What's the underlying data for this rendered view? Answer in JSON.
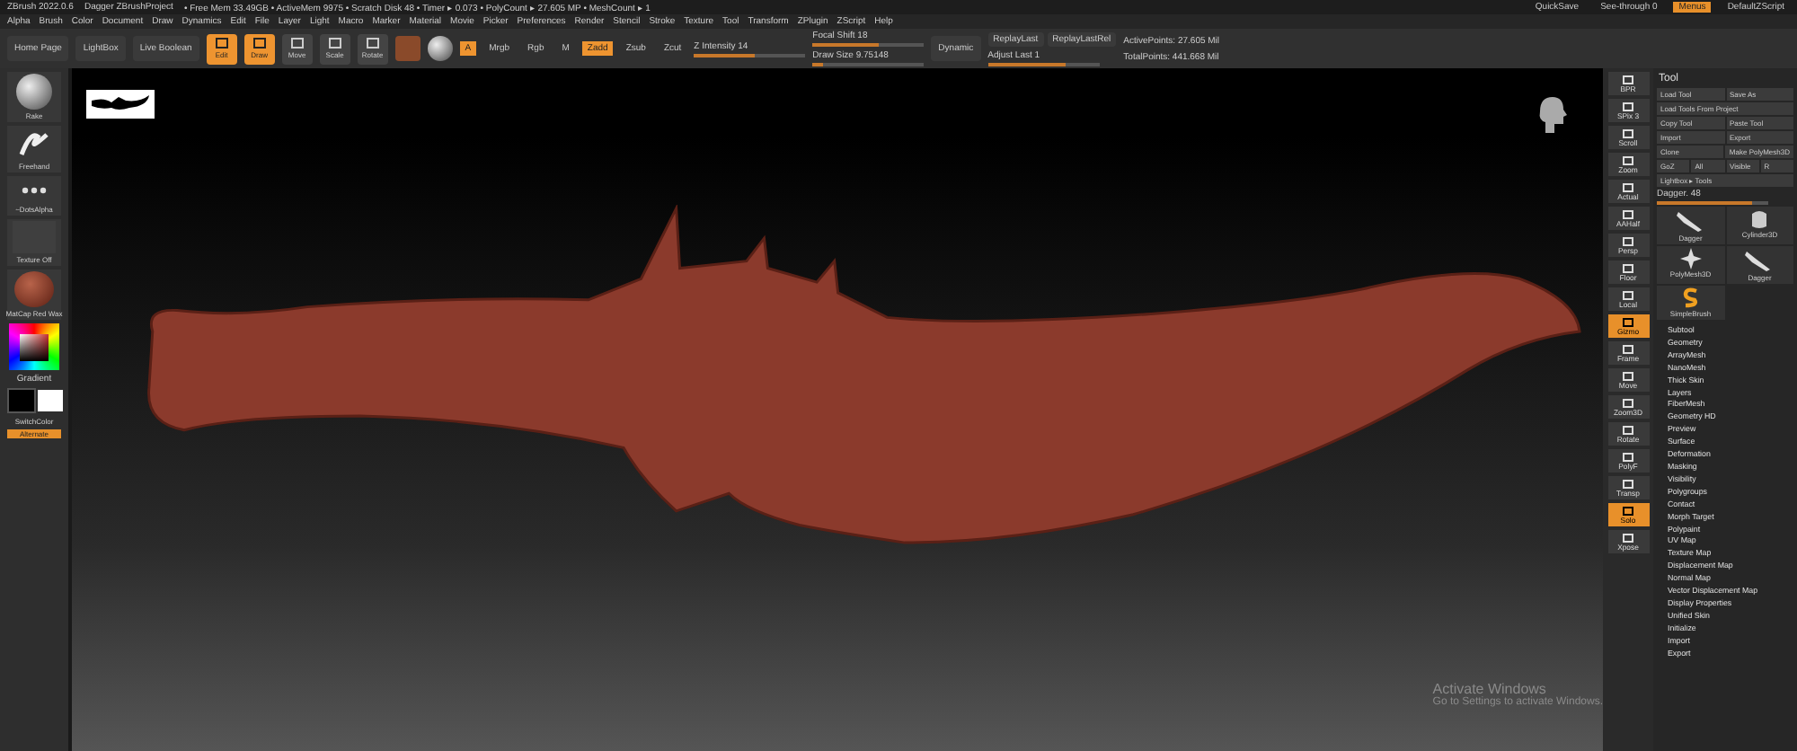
{
  "title_bar": {
    "app": "ZBrush 2022.0.6",
    "project": "Dagger ZBrushProject",
    "stats": "• Free Mem 33.49GB • ActiveMem 9975 • Scratch Disk 48 • Timer ▸ 0.073 • PolyCount ▸ 27.605 MP • MeshCount ▸ 1"
  },
  "title_buttons": [
    {
      "label": "QuickSave",
      "selected": false
    },
    {
      "label": "See-through 0",
      "selected": false
    },
    {
      "label": "Menus",
      "selected": true
    },
    {
      "label": "DefaultZScript",
      "selected": false
    }
  ],
  "menu": [
    "Alpha",
    "Brush",
    "Color",
    "Document",
    "Draw",
    "Dynamics",
    "Edit",
    "File",
    "Layer",
    "Light",
    "Macro",
    "Marker",
    "Material",
    "Movie",
    "Picker",
    "Preferences",
    "Render",
    "Stencil",
    "Stroke",
    "Texture",
    "Tool",
    "Transform",
    "ZPlugin",
    "ZScript",
    "Help"
  ],
  "toolbar": {
    "nav": [
      "Home Page",
      "LightBox",
      "Live Boolean"
    ],
    "modes": [
      {
        "label": "Edit",
        "selected": true
      },
      {
        "label": "Draw",
        "selected": true
      },
      {
        "label": "Move",
        "selected": false
      },
      {
        "label": "Scale",
        "selected": false
      },
      {
        "label": "Rotate",
        "selected": false
      }
    ],
    "channels": [
      {
        "label": "A",
        "selected": true
      },
      {
        "label": "Mrgb",
        "selected": false
      },
      {
        "label": "Rgb",
        "selected": false
      },
      {
        "label": "M",
        "selected": false
      },
      {
        "label": "Zadd",
        "selected": true
      },
      {
        "label": "Zsub",
        "selected": false
      },
      {
        "label": "Zcut",
        "selected": false
      }
    ],
    "sliders": [
      {
        "label": "Z Intensity 14",
        "level": 0.55
      },
      {
        "label": "Focal Shift 18",
        "level": 0.6
      },
      {
        "label": "Draw Size 9.75148",
        "level": 0.1
      },
      {
        "label": "Adjust Last 1",
        "level": 0.7
      }
    ],
    "dynamic": "Dynamic",
    "replay": [
      "ReplayLast",
      "ReplayLastRel"
    ],
    "stats": [
      "ActivePoints: 27.605 Mil",
      "TotalPoints: 441.668 Mil"
    ]
  },
  "left_shelf": {
    "brush": "Rake",
    "stroke": "Freehand",
    "alpha": "~DotsAlpha",
    "texture": "Texture Off",
    "material": "MatCap Red Wax",
    "gradient": "Gradient",
    "switch": "SwitchColor",
    "alternate": {
      "label": "Alternate",
      "selected": true
    }
  },
  "right_shelf": [
    {
      "label": "BPR",
      "selected": false
    },
    {
      "label": "SPix 3",
      "selected": false
    },
    {
      "label": "Scroll",
      "selected": false
    },
    {
      "label": "Zoom",
      "selected": false
    },
    {
      "label": "Actual",
      "selected": false
    },
    {
      "label": "AAHalf",
      "selected": false
    },
    {
      "label": "Persp",
      "selected": false
    },
    {
      "label": "Floor",
      "selected": false
    },
    {
      "label": "Local",
      "selected": false
    },
    {
      "label": "Gizmo",
      "selected": true
    },
    {
      "label": "Frame",
      "selected": false
    },
    {
      "label": "Move",
      "selected": false
    },
    {
      "label": "Zoom3D",
      "selected": false
    },
    {
      "label": "Rotate",
      "selected": false
    },
    {
      "label": "PolyF",
      "selected": false
    },
    {
      "label": "Transp",
      "selected": false
    },
    {
      "label": "Solo",
      "selected": true
    },
    {
      "label": "Xpose",
      "selected": false
    }
  ],
  "tool_panel": {
    "title": "Tool",
    "button_rows": [
      [
        "Load Tool",
        "Save As"
      ],
      [
        "Load Tools From Project"
      ],
      [
        "Copy Tool",
        "Paste Tool"
      ],
      [
        "Import",
        "Export"
      ],
      [
        "Clone",
        "Make PolyMesh3D"
      ],
      [
        "GoZ",
        "All",
        "Visible",
        "R"
      ],
      [
        "Lightbox ▸ Tools"
      ]
    ],
    "slider": {
      "label": "Dagger. 48",
      "level": 0.85
    },
    "thumbs": [
      {
        "label": "Dagger",
        "kind": "dagger"
      },
      {
        "label": "Cylinder3D",
        "kind": "cylinder"
      },
      {
        "label": "PolyMesh3D",
        "kind": "star"
      },
      {
        "label": "Dagger",
        "kind": "dagger"
      },
      {
        "label": "SimpleBrush",
        "kind": "brush"
      }
    ],
    "sections": [
      "Subtool",
      "Geometry",
      "ArrayMesh",
      "NanoMesh",
      "Thick Skin",
      "Layers",
      "FiberMesh",
      "Geometry HD",
      "Preview",
      "Surface",
      "Deformation",
      "Masking",
      "Visibility",
      "Polygroups",
      "Contact",
      "Morph Target",
      "Polypaint",
      "UV Map",
      "Texture Map",
      "Displacement Map",
      "Normal Map",
      "Vector Displacement Map",
      "Display Properties",
      "Unified Skin",
      "Initialize",
      "Import",
      "Export"
    ]
  },
  "notice": {
    "title": "Activate Windows",
    "text": "Go to Settings to activate Windows."
  }
}
